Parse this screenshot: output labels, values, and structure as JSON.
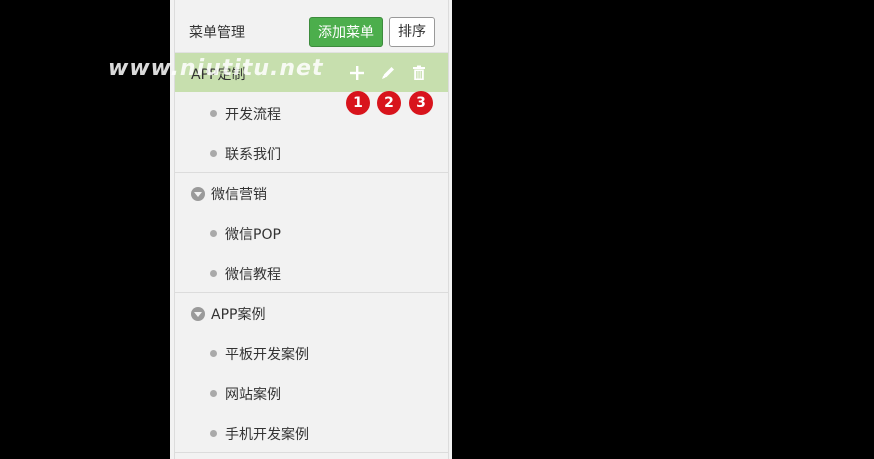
{
  "header": {
    "title": "菜单管理",
    "add_label": "添加菜单",
    "sort_label": "排序"
  },
  "menu": {
    "group1": {
      "label": "APP定制",
      "subitems": [
        "开发流程",
        "联系我们"
      ]
    },
    "group2": {
      "label": "微信营销",
      "subitems": [
        "微信POP",
        "微信教程"
      ]
    },
    "group3": {
      "label": "APP案例",
      "subitems": [
        "平板开发案例",
        "网站案例",
        "手机开发案例"
      ]
    }
  },
  "actions": {
    "add_icon": "plus-icon",
    "edit_icon": "pencil-icon",
    "delete_icon": "trash-icon"
  },
  "badges": [
    "1",
    "2",
    "3"
  ],
  "watermark": "www.niutitu.net",
  "colors": {
    "active_row": "#c7dfae",
    "add_button": "#4cae4c",
    "badge": "#d8141c"
  }
}
